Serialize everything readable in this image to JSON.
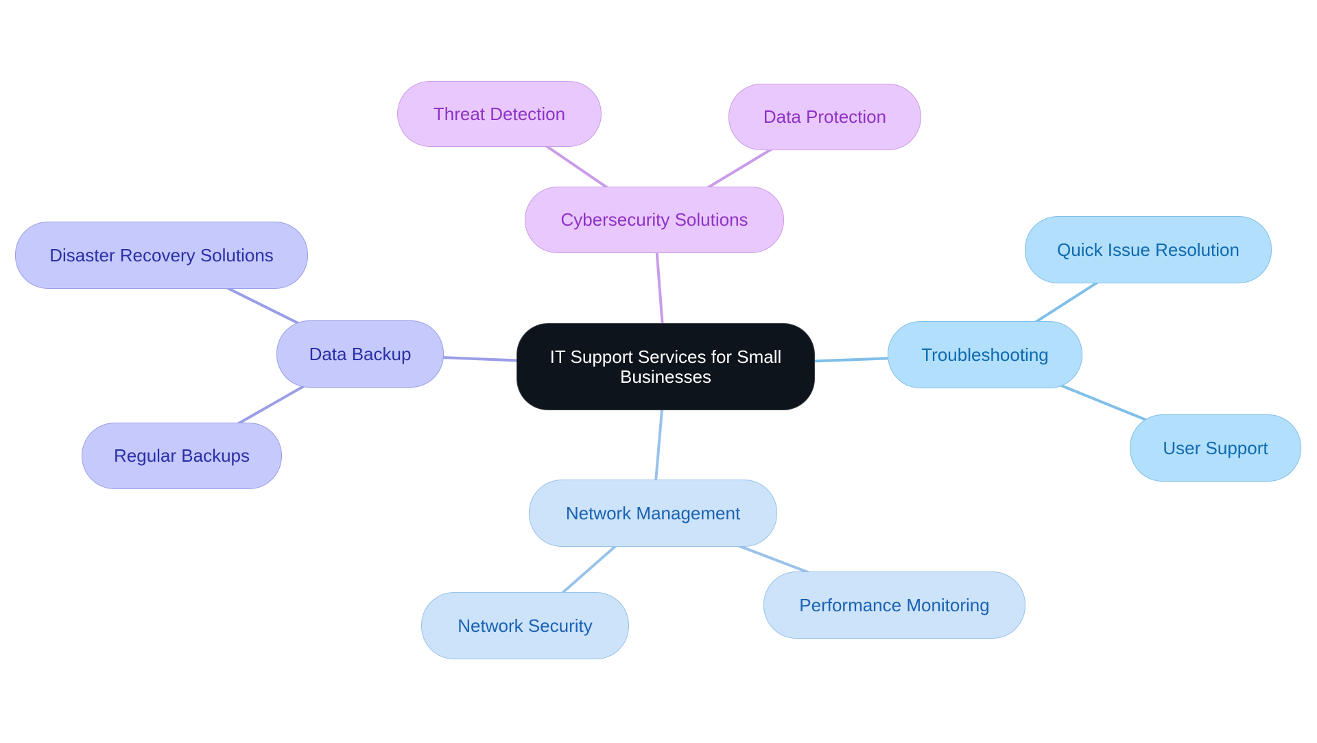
{
  "diagram": {
    "type": "mind-map",
    "root": {
      "label": "IT Support Services for Small Businesses"
    },
    "branches": [
      {
        "id": "cyber",
        "label": "Cybersecurity Solutions",
        "color": "#c99be9",
        "children": [
          {
            "label": "Threat Detection"
          },
          {
            "label": "Data Protection"
          }
        ]
      },
      {
        "id": "backup",
        "label": "Data Backup",
        "color": "#9a9ee8",
        "children": [
          {
            "label": "Disaster Recovery Solutions"
          },
          {
            "label": "Regular Backups"
          }
        ]
      },
      {
        "id": "trouble",
        "label": "Troubleshooting",
        "color": "#7fbfe9",
        "children": [
          {
            "label": "Quick Issue Resolution"
          },
          {
            "label": "User Support"
          }
        ]
      },
      {
        "id": "network",
        "label": "Network Management",
        "color": "#98c2ea",
        "children": [
          {
            "label": "Network Security"
          },
          {
            "label": "Performance Monitoring"
          }
        ]
      }
    ]
  }
}
